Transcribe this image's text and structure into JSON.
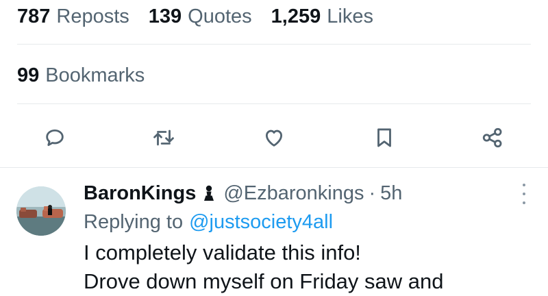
{
  "stats": {
    "reposts": {
      "count": "787",
      "label": "Reposts"
    },
    "quotes": {
      "count": "139",
      "label": "Quotes"
    },
    "likes": {
      "count": "1,259",
      "label": "Likes"
    }
  },
  "bookmarks": {
    "count": "99",
    "label": "Bookmarks"
  },
  "actions": [
    "reply-icon",
    "repost-icon",
    "like-icon",
    "bookmark-icon",
    "share-icon"
  ],
  "reply": {
    "name": "BaronKings",
    "badge_icon": "pawn-icon",
    "handle": "@Ezbaronkings",
    "separator": "·",
    "time": "5h",
    "replying_label": "Replying to",
    "replying_to": "@justsociety4all",
    "lines": [
      "I completely validate this info!",
      "Drove down myself on Friday saw and"
    ]
  },
  "colors": {
    "text": "#0f1419",
    "muted": "#536471",
    "link": "#1d9bf0",
    "divider": "#e6e9ec"
  }
}
